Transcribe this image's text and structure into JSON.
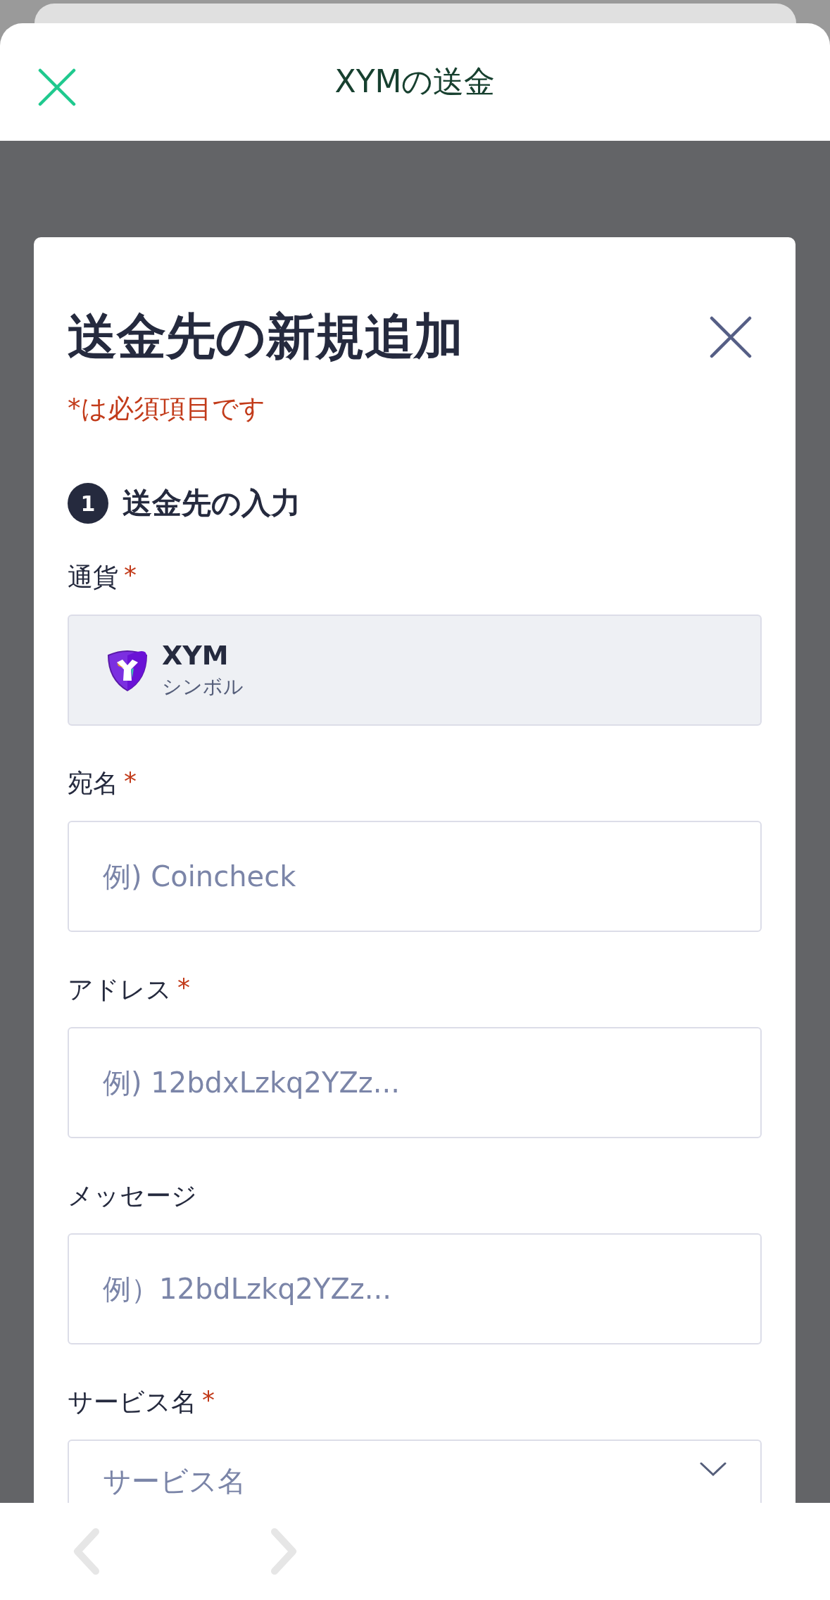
{
  "header": {
    "title": "XYMの送金"
  },
  "modal": {
    "title": "送金先の新規追加",
    "required_note": "*は必須項目です",
    "step": {
      "number": "1",
      "label": "送金先の入力"
    },
    "fields": [
      {
        "kind": "currency",
        "label": "通貨",
        "mark": "*",
        "symbol": "XYM",
        "name": "シンボル"
      },
      {
        "kind": "text",
        "label": "宛名",
        "mark": "*",
        "placeholder": "例) Coincheck"
      },
      {
        "kind": "text",
        "label": "アドレス",
        "mark": "*",
        "placeholder": "例) 12bdxLzkq2YZz..."
      },
      {
        "kind": "text",
        "label": "メッセージ",
        "placeholder": "例）12bdLzkq2YZz..."
      },
      {
        "kind": "select",
        "label": "サービス名",
        "mark": "*",
        "placeholder": "サービス名"
      }
    ]
  },
  "nav": {
    "back_enabled": false,
    "forward_enabled": false
  }
}
